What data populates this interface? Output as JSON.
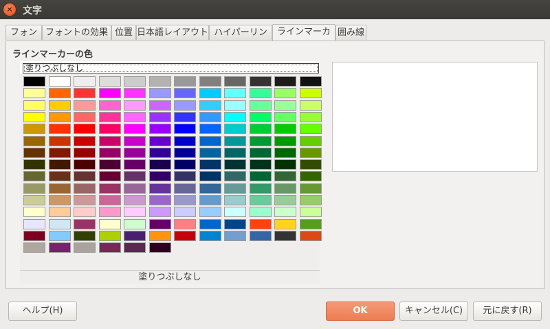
{
  "window": {
    "title": "文字"
  },
  "tabs": [
    "フォント",
    "フォントの効果",
    "位置",
    "日本語レイアウト",
    "ハイパーリンク",
    "ラインマーカー",
    "囲み線"
  ],
  "active_tab": "ラインマーカー",
  "highlight": {
    "section_label": "ラインマーカーの色",
    "none_label": "塗りつぶしなし",
    "footer_label": "塗りつぶしなし"
  },
  "palette_rows": [
    [
      "#000000",
      "#ffffff",
      "#eeeeee",
      "#dddddd",
      "#cccccc",
      "#b2b2b2",
      "#999999",
      "#808080",
      "#666666",
      "#333333",
      "#1c1c1c",
      "#111111"
    ],
    [
      "#ffff99",
      "#ff6600",
      "#ff3333",
      "#ff00ff",
      "#ff33ff",
      "#9999ff",
      "#6666ff",
      "#00ccff",
      "#66ffff",
      "#33ff99",
      "#99ff66",
      "#ccff00"
    ],
    [
      "#ffff66",
      "#ffcc00",
      "#ff9999",
      "#ff66cc",
      "#ff99ff",
      "#cc66ff",
      "#9999ff",
      "#33ccff",
      "#99ffff",
      "#66ff99",
      "#99ff99",
      "#ccff66"
    ],
    [
      "#ffff00",
      "#ff9900",
      "#ff6666",
      "#ff3399",
      "#ff66ff",
      "#9933ff",
      "#3333ff",
      "#3399ff",
      "#00ffff",
      "#00ff66",
      "#66ff66",
      "#99ff33"
    ],
    [
      "#cc9900",
      "#ff3300",
      "#ff0000",
      "#ff0066",
      "#ff00ff",
      "#9900ff",
      "#0000ff",
      "#0066ff",
      "#00cccc",
      "#00cc33",
      "#00cc00",
      "#66ff00"
    ],
    [
      "#996600",
      "#cc3300",
      "#cc0000",
      "#cc0066",
      "#cc00cc",
      "#6600cc",
      "#0000cc",
      "#0066cc",
      "#009999",
      "#009933",
      "#009900",
      "#66cc00"
    ],
    [
      "#663300",
      "#801900",
      "#990000",
      "#990066",
      "#990099",
      "#330099",
      "#000099",
      "#006699",
      "#006666",
      "#006633",
      "#006600",
      "#669900"
    ],
    [
      "#333300",
      "#401900",
      "#4d0000",
      "#4d0033",
      "#660066",
      "#1a004d",
      "#000066",
      "#003366",
      "#003333",
      "#003319",
      "#003300",
      "#334d00"
    ],
    [
      "#666633",
      "#663319",
      "#663333",
      "#660033",
      "#663366",
      "#330066",
      "#333366",
      "#003366",
      "#336666",
      "#006633",
      "#336633",
      "#336600"
    ],
    [
      "#999966",
      "#996633",
      "#996666",
      "#993366",
      "#996699",
      "#663399",
      "#666699",
      "#336699",
      "#669999",
      "#339966",
      "#669966",
      "#669933"
    ],
    [
      "#cccc99",
      "#cc9966",
      "#cc9999",
      "#cc6699",
      "#cc99cc",
      "#9966cc",
      "#9999cc",
      "#6699cc",
      "#99cccc",
      "#66cc99",
      "#99cc99",
      "#99cc66"
    ],
    [
      "#ffffcc",
      "#ffcc99",
      "#ffcccc",
      "#ff99cc",
      "#ffccff",
      "#cc99ff",
      "#ccccff",
      "#99ccff",
      "#ccffff",
      "#99ffcc",
      "#ccffcc",
      "#ccff99"
    ],
    [
      "#e6e6ff",
      "#cfe7f5",
      "#993366",
      "#ffffcc",
      "#ccffcc",
      "#660066",
      "#ff8080",
      "#0066cc",
      "#004586",
      "#ff420e",
      "#ffd320",
      "#579d1c"
    ],
    [
      "#7e0021",
      "#83caff",
      "#314004",
      "#aecf00",
      "#4b1f6f",
      "#ff950e",
      "#c5000b",
      "#0084d1",
      "#729fcf",
      "#3465a4",
      "#333333",
      "#dd4814"
    ],
    [
      "#aea79f",
      "#77216f",
      "#a8a39d",
      "#772953",
      "#5e2750",
      "#2c001e"
    ]
  ],
  "buttons": {
    "help": "ヘルプ(H)",
    "ok": "OK",
    "cancel": "キャンセル(C)",
    "reset": "元に戻す(R)"
  }
}
